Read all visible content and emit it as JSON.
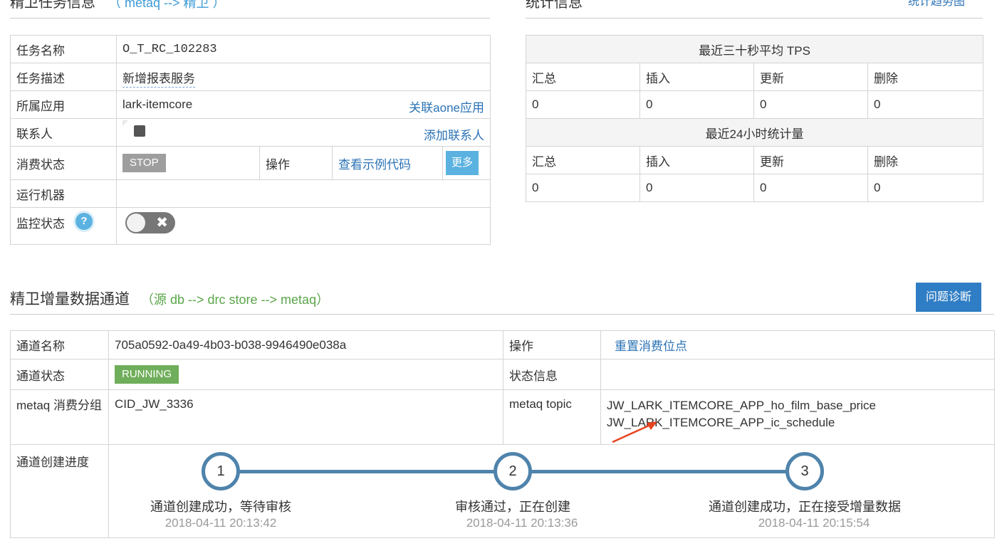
{
  "task_section": {
    "title": "精卫任务信息",
    "subtitle": "（ metaq --> 精卫 ）",
    "rows": {
      "name_label": "任务名称",
      "name_value": "O_T_RC_102283",
      "desc_label": "任务描述",
      "desc_value": "新增报表服务",
      "app_label": "所属应用",
      "app_value": "lark-itemcore",
      "app_link": "关联aone应用",
      "contact_label": "联系人",
      "contact_link": "添加联系人",
      "consume_label": "消费状态",
      "consume_status": "STOP",
      "op_label": "操作",
      "sample_link": "查看示例代码",
      "more_button": "更多",
      "machine_label": "运行机器",
      "monitor_label": "监控状态",
      "help_icon_glyph": "?",
      "toggle_glyph": "✖"
    }
  },
  "stats_section": {
    "title": "统计信息",
    "trend_link": "统计趋势图",
    "tps_header": "最近三十秒平均 TPS",
    "day_header": "最近24小时统计量",
    "columns": [
      "汇总",
      "插入",
      "更新",
      "删除"
    ],
    "tps_values": [
      "0",
      "0",
      "0",
      "0"
    ],
    "day_values": [
      "0",
      "0",
      "0",
      "0"
    ]
  },
  "channel_section": {
    "title": "精卫增量数据通道",
    "subtitle": "（源 db --> drc store --> metaq）",
    "diag_button": "问题诊断",
    "name_label": "通道名称",
    "name_value": "705a0592-0a49-4b03-b038-9946490e038a",
    "op_label": "操作",
    "reset_link": "重置消费位点",
    "status_label": "通道状态",
    "status_value": "RUNNING",
    "status_info_label": "状态信息",
    "group_label": "metaq 消费分组",
    "group_value": "CID_JW_3336",
    "topic_label": "metaq topic",
    "topics": [
      "JW_LARK_ITEMCORE_APP_ho_film_base_price",
      "JW_LARK_ITEMCORE_APP_ic_schedule"
    ],
    "progress_label": "通道创建进度",
    "steps": [
      {
        "num": "1",
        "label": "通道创建成功，等待审核",
        "time": "2018-04-11 20:13:42"
      },
      {
        "num": "2",
        "label": "审核通过，正在创建",
        "time": "2018-04-11 20:13:36"
      },
      {
        "num": "3",
        "label": "通道创建成功，正在接受增量数据",
        "time": "2018-04-11 20:15:54"
      }
    ]
  },
  "colors": {
    "link": "#2a72b5",
    "running": "#6fae5a",
    "stop": "#9e9e9e",
    "progress": "#4f83ab",
    "annotation_arrow": "#e8431f"
  }
}
